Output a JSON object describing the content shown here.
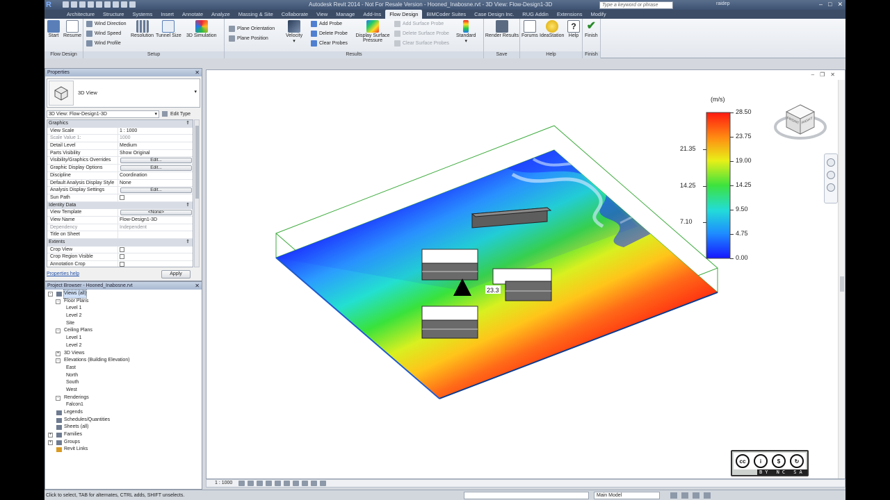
{
  "titlebar": {
    "title": "Autodesk Revit 2014 - Not For Resale Version -  Hooned_Inabosne.rvt - 3D View: Flow-Design1-3D",
    "search_placeholder": "Type a keyword or phrase",
    "user": "raidep"
  },
  "tabs": [
    "Architecture",
    "Structure",
    "Systems",
    "Insert",
    "Annotate",
    "Analyze",
    "Massing & Site",
    "Collaborate",
    "View",
    "Manage",
    "Add-Ins",
    "Flow Design",
    "BIMCoder Suites",
    "Case Design Inc.",
    "RUG Addin",
    "Extensions",
    "Modify"
  ],
  "active_tab": "Flow Design",
  "ribbon": {
    "flowdesign": {
      "title": "Flow Design",
      "start": "Start",
      "resume": "Resume"
    },
    "setup": {
      "title": "Setup",
      "wind_direction": "Wind Direction",
      "wind_speed": "Wind Speed",
      "wind_profile": "Wind Profile",
      "resolution": "Resolution",
      "tunnel_size": "Tunnel Size",
      "sim3d": "3D Simulation"
    },
    "results": {
      "title": "Results",
      "plane_orientation": "Plane Orientation",
      "plane_position": "Plane Position",
      "velocity": "Velocity",
      "add_probe": "Add Probe",
      "delete_probe": "Delete Probe",
      "clear_probes": "Clear Probes",
      "display_surface_pressure": "Display Surface Pressure",
      "add_surface_probe": "Add Surface Probe",
      "delete_surface_probe": "Delete Surface Probe",
      "clear_surface_probes": "Clear Surface Probes",
      "standard": "Standard"
    },
    "save": {
      "title": "Save",
      "render_results": "Render Results"
    },
    "help": {
      "title": "Help",
      "forums": "Forums",
      "ideastation": "IdeaStation",
      "help": "Help"
    },
    "finish": {
      "title": "Finish",
      "finish": "Finish"
    }
  },
  "properties": {
    "title": "Properties",
    "type_name": "3D View",
    "view_selector": "3D View: Flow-Design1-3D",
    "edit_type": "Edit Type",
    "groups": [
      {
        "name": "Graphics",
        "rows": [
          {
            "k": "View Scale",
            "v": "1 : 1000",
            "kind": "text"
          },
          {
            "k": "Scale Value    1:",
            "v": "1000",
            "kind": "gray"
          },
          {
            "k": "Detail Level",
            "v": "Medium",
            "kind": "text"
          },
          {
            "k": "Parts Visibility",
            "v": "Show Original",
            "kind": "text"
          },
          {
            "k": "Visibility/Graphics Overrides",
            "v": "Edit...",
            "kind": "btn"
          },
          {
            "k": "Graphic Display Options",
            "v": "Edit...",
            "kind": "btn"
          },
          {
            "k": "Discipline",
            "v": "Coordination",
            "kind": "text"
          },
          {
            "k": "Default Analysis Display Style",
            "v": "None",
            "kind": "text"
          },
          {
            "k": "Analysis Display Settings",
            "v": "Edit...",
            "kind": "btn"
          },
          {
            "k": "Sun Path",
            "v": "",
            "kind": "cb"
          }
        ]
      },
      {
        "name": "Identity Data",
        "rows": [
          {
            "k": "View Template",
            "v": "<None>",
            "kind": "btn"
          },
          {
            "k": "View Name",
            "v": "Flow-Design1-3D",
            "kind": "text"
          },
          {
            "k": "Dependency",
            "v": "Independent",
            "kind": "gray"
          },
          {
            "k": "Title on Sheet",
            "v": "",
            "kind": "text"
          }
        ]
      },
      {
        "name": "Extents",
        "rows": [
          {
            "k": "Crop View",
            "v": "",
            "kind": "cb"
          },
          {
            "k": "Crop Region Visible",
            "v": "",
            "kind": "cb"
          },
          {
            "k": "Annotation Crop",
            "v": "",
            "kind": "cb"
          }
        ]
      }
    ],
    "help_link": "Properties help",
    "apply": "Apply"
  },
  "browser": {
    "title": "Project Browser - Hooned_Inabosne.rvt",
    "nodes": [
      {
        "label": "Views (all)",
        "level": 0,
        "pm": "-",
        "sel": true
      },
      {
        "label": "Floor Plans",
        "level": 1,
        "pm": "-"
      },
      {
        "label": "Level 1",
        "level": 2
      },
      {
        "label": "Level 2",
        "level": 2
      },
      {
        "label": "Site",
        "level": 2
      },
      {
        "label": "Ceiling Plans",
        "level": 1,
        "pm": "-"
      },
      {
        "label": "Level 1",
        "level": 2
      },
      {
        "label": "Level 2",
        "level": 2
      },
      {
        "label": "3D Views",
        "level": 1,
        "pm": "+"
      },
      {
        "label": "Elevations (Building Elevation)",
        "level": 1,
        "pm": "-"
      },
      {
        "label": "East",
        "level": 2
      },
      {
        "label": "North",
        "level": 2
      },
      {
        "label": "South",
        "level": 2
      },
      {
        "label": "West",
        "level": 2
      },
      {
        "label": "Renderings",
        "level": 1,
        "pm": "-"
      },
      {
        "label": "Falcon1",
        "level": 2
      },
      {
        "label": "Legends",
        "level": 0,
        "icon": true
      },
      {
        "label": "Schedules/Quantities",
        "level": 0,
        "icon": true
      },
      {
        "label": "Sheets (all)",
        "level": 0,
        "icon": true
      },
      {
        "label": "Families",
        "level": 0,
        "pm": "+",
        "icon": true
      },
      {
        "label": "Groups",
        "level": 0,
        "pm": "+",
        "icon": true
      },
      {
        "label": "Revit Links",
        "level": 0,
        "icon": true
      }
    ]
  },
  "legend": {
    "unit": "(m/s)",
    "right_values": [
      "28.50",
      "23.75",
      "19.00",
      "14.25",
      "9.50",
      "4.75",
      "0.00"
    ],
    "left_values": [
      "21.35",
      "14.25",
      "7.10"
    ]
  },
  "scene": {
    "probe_value": "23.3"
  },
  "viewcube": {
    "face_left": "FRONT",
    "face_right": "RIGHT"
  },
  "cc_badge": {
    "text": "BY NC SA"
  },
  "viewbar": {
    "scale": "1 : 1000"
  },
  "status": {
    "message": "Click to select, TAB for alternates, CTRL adds, SHIFT unselects.",
    "model": "Main Model"
  },
  "colors": {
    "ribbon_tab_active": "#eef1f5",
    "title_bar": "#3e5272"
  }
}
